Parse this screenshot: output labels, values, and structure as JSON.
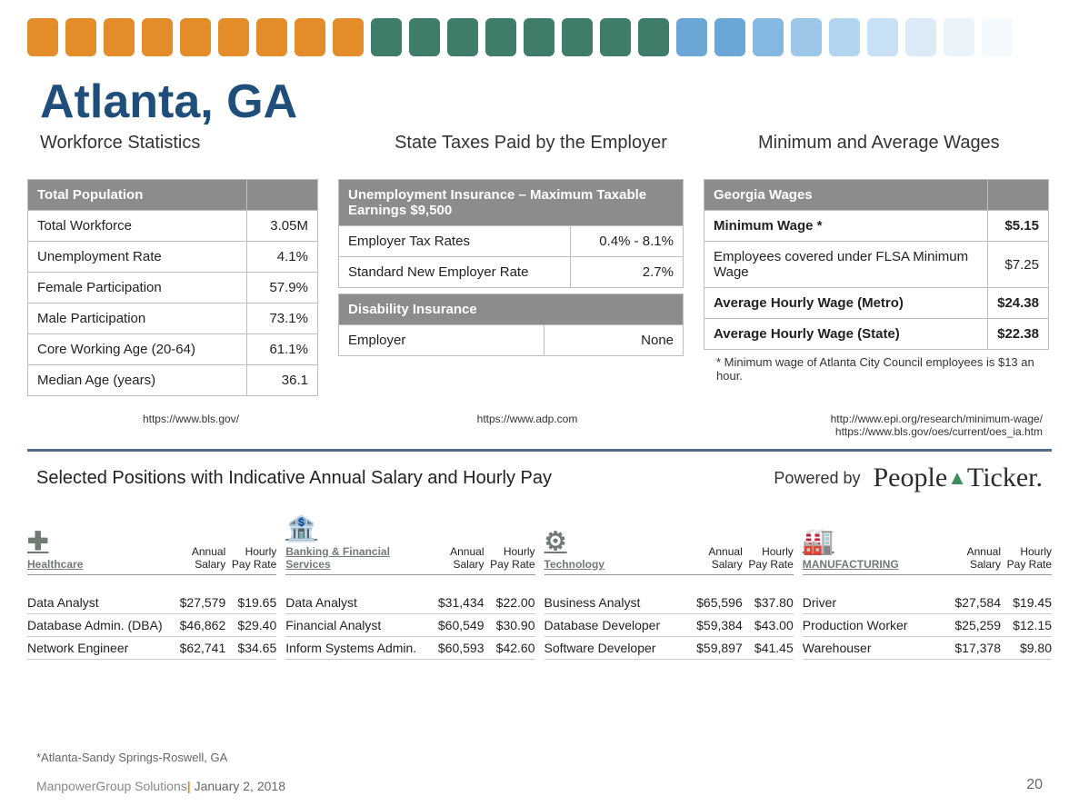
{
  "header": {
    "title": "Atlanta, GA",
    "sub1": "Workforce Statistics",
    "sub2": "State Taxes Paid by the Employer",
    "sub3": "Minimum and Average Wages",
    "bar_colors": [
      "#e48b2a",
      "#e48b2a",
      "#e48b2a",
      "#e48b2a",
      "#e48b2a",
      "#e48b2a",
      "#e48b2a",
      "#e48b2a",
      "#e48b2a",
      "#3f7d6a",
      "#3f7d6a",
      "#3f7d6a",
      "#3f7d6a",
      "#3f7d6a",
      "#3f7d6a",
      "#3f7d6a",
      "#3f7d6a",
      "#6aa6d6",
      "#6aa6d6",
      "#84b8e0",
      "#9cc7e8",
      "#b4d5ef",
      "#c9e1f4",
      "#dceaf7",
      "#eaf3fa",
      "#f4f9fd"
    ]
  },
  "workforce": {
    "header": "Total Population",
    "rows": [
      {
        "label": "Total Workforce",
        "value": "3.05M"
      },
      {
        "label": "Unemployment Rate",
        "value": "4.1%"
      },
      {
        "label": "Female Participation",
        "value": "57.9%"
      },
      {
        "label": "Male Participation",
        "value": "73.1%"
      },
      {
        "label": "Core Working Age (20-64)",
        "value": "61.1%"
      },
      {
        "label": "Median Age (years)",
        "value": "36.1"
      }
    ]
  },
  "taxes": {
    "ui_header": "Unemployment Insurance – Maximum Taxable Earnings $9,500",
    "ui_rows": [
      {
        "label": "Employer Tax Rates",
        "value": "0.4% - 8.1%"
      },
      {
        "label": "Standard New Employer Rate",
        "value": "2.7%"
      }
    ],
    "di_header": "Disability Insurance",
    "di_rows": [
      {
        "label": "Employer",
        "value": "None"
      }
    ]
  },
  "wages": {
    "header": "Georgia Wages",
    "rows": [
      {
        "label": "Minimum Wage *",
        "value": "$5.15",
        "bold": true
      },
      {
        "label": "Employees covered under FLSA Minimum Wage",
        "value": "$7.25",
        "bold": false
      },
      {
        "label": "Average Hourly Wage (Metro)",
        "value": "$24.38",
        "bold": true
      },
      {
        "label": "Average Hourly Wage (State)",
        "value": "$22.38",
        "bold": true
      }
    ],
    "footnote": "* Minimum wage of Atlanta City Council employees is $13 an hour."
  },
  "sources": {
    "s1": "https://www.bls.gov/",
    "s2": "https://www.adp.com",
    "s3a": "http://www.epi.org/research/minimum-wage/",
    "s3b": "https://www.bls.gov/oes/current/oes_ia.htm"
  },
  "positions": {
    "heading": "Selected Positions with Indicative Annual Salary and Hourly Pay",
    "powered_label": "Powered by",
    "logo_text": "People▲Ticker.",
    "col_annual": "Annual Salary",
    "col_hourly": "Hourly Pay Rate",
    "sectors": [
      {
        "name": "Healthcare",
        "icon": "✚",
        "rows": [
          {
            "name": "Data Analyst",
            "salary": "$27,579",
            "rate": "$19.65"
          },
          {
            "name": "Database Admin. (DBA)",
            "salary": "$46,862",
            "rate": "$29.40"
          },
          {
            "name": "Network Engineer",
            "salary": "$62,741",
            "rate": "$34.65"
          }
        ]
      },
      {
        "name": "Banking & Financial Services",
        "icon": "🏦",
        "rows": [
          {
            "name": "Data Analyst",
            "salary": "$31,434",
            "rate": "$22.00"
          },
          {
            "name": "Financial Analyst",
            "salary": "$60,549",
            "rate": "$30.90"
          },
          {
            "name": "Inform Systems Admin.",
            "salary": "$60,593",
            "rate": "$42.60"
          }
        ]
      },
      {
        "name": "Technology",
        "icon": "⚙",
        "rows": [
          {
            "name": "Business Analyst",
            "salary": "$65,596",
            "rate": "$37.80"
          },
          {
            "name": "Database Developer",
            "salary": "$59,384",
            "rate": "$43.00"
          },
          {
            "name": "Software Developer",
            "salary": "$59,897",
            "rate": "$41.45"
          }
        ]
      },
      {
        "name": "MANUFACTURING",
        "icon": "🏭",
        "rows": [
          {
            "name": "Driver",
            "salary": "$27,584",
            "rate": "$19.45"
          },
          {
            "name": "Production Worker",
            "salary": "$25,259",
            "rate": "$12.15"
          },
          {
            "name": "Warehouser",
            "salary": "$17,378",
            "rate": "$9.80"
          }
        ]
      }
    ]
  },
  "footer": {
    "geo_note": "*Atlanta-Sandy Springs-Roswell, GA",
    "brand": "ManpowerGroup Solutions",
    "date": "January 2, 2018",
    "page": "20"
  }
}
